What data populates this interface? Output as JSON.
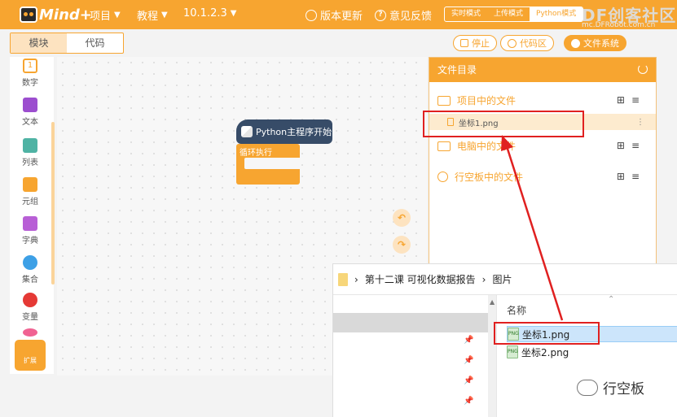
{
  "topbar": {
    "logo_text": "Mind+",
    "menus": [
      {
        "label": "项目"
      },
      {
        "label": "教程"
      },
      {
        "label": "10.1.2.3"
      }
    ],
    "update_label": "版本更新",
    "feedback_label": "意见反馈",
    "modes": [
      {
        "label": "实时模式"
      },
      {
        "label": "上传模式"
      },
      {
        "label": "Python模式"
      }
    ],
    "selected_mode": "Python模式",
    "brand_title": "DF创客社区",
    "brand_url": "mc.DFRobot.com.cn",
    "accent_color": "#f7a530"
  },
  "tabs": {
    "blocks": "模块",
    "code": "代码",
    "active": "模块"
  },
  "controls": {
    "stop": "停止",
    "code_area": "代码区",
    "file_system": "文件系统"
  },
  "categories": [
    {
      "label": "数字",
      "color": "#f7a530"
    },
    {
      "label": "文本",
      "color": "#9c4ecf"
    },
    {
      "label": "列表",
      "color": "#4fb3a4"
    },
    {
      "label": "元组",
      "color": "#f7a530"
    },
    {
      "label": "字典",
      "color": "#b85fd6"
    },
    {
      "label": "集合",
      "color": "#3da0e6"
    },
    {
      "label": "变量",
      "color": "#e53935"
    }
  ],
  "extension_label": "扩展",
  "blocks": {
    "hat_label": "Python主程序开始",
    "loop_label": "循环执行"
  },
  "file_panel": {
    "title": "文件目录",
    "sections": [
      {
        "label": "项目中的文件"
      },
      {
        "label": "电脑中的文件"
      },
      {
        "label": "行空板中的文件"
      }
    ],
    "project_file": "坐标1.png"
  },
  "explorer": {
    "breadcrumb": [
      "第十二课 可视化数据报告",
      "图片"
    ],
    "column_name": "名称",
    "files": [
      {
        "name": "坐标1.png",
        "icon_label": "PNG"
      },
      {
        "name": "坐标2.png",
        "icon_label": "PNG"
      }
    ]
  },
  "watermark": "行空板"
}
